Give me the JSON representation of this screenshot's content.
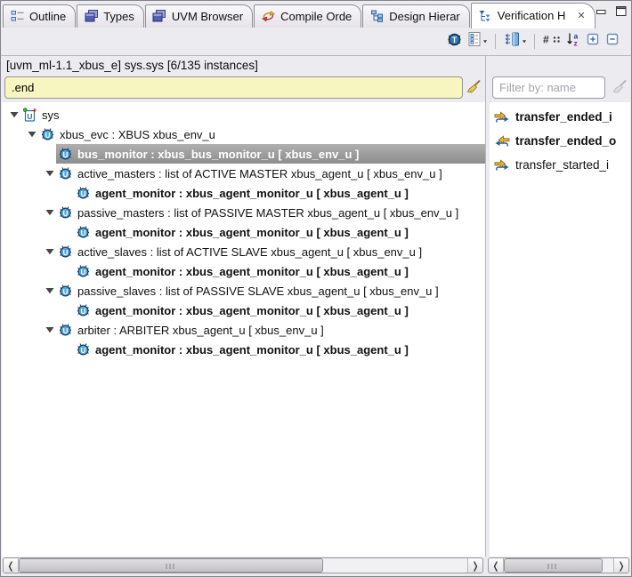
{
  "tabs": [
    {
      "label": "Outline",
      "icon": "outline-icon"
    },
    {
      "label": "Types",
      "icon": "types-icon"
    },
    {
      "label": "UVM Browser",
      "icon": "uvm-browser-icon"
    },
    {
      "label": "Compile Orde",
      "icon": "compile-order-icon"
    },
    {
      "label": "Design Hierar",
      "icon": "design-hierarchy-icon"
    },
    {
      "label": "Verification H",
      "icon": "verification-hierarchy-icon",
      "active": true,
      "close_icon": "close-icon"
    }
  ],
  "window_controls": [
    {
      "icon": "minimize-icon"
    },
    {
      "icon": "maximize-icon"
    }
  ],
  "toolbar": {
    "buttons": [
      {
        "icon": "type-filter-bug-icon"
      },
      {
        "icon": "checklist-icon",
        "dropdown": true
      },
      {
        "separator": true
      },
      {
        "icon": "column-settings-icon",
        "dropdown": true
      },
      {
        "separator": true
      },
      {
        "icon": "hash-columns-icon"
      },
      {
        "icon": "sort-az-icon"
      },
      {
        "icon": "expand-all-icon"
      },
      {
        "icon": "collapse-all-icon"
      }
    ]
  },
  "context_bar": {
    "label": "[uvm_ml-1.1_xbus_e] sys.sys [6/135 instances]"
  },
  "search": {
    "value": ".end",
    "clear_icon": "broom-icon"
  },
  "filter": {
    "placeholder": "Filter by: name",
    "clear_icon": "broom-icon-disabled"
  },
  "tree": {
    "rows": [
      {
        "label": "sys",
        "level": 0,
        "icon": "uvm-top-unit-icon",
        "expandable": true,
        "bold": false,
        "selected": false
      },
      {
        "label": "xbus_evc : XBUS xbus_env_u",
        "level": 1,
        "icon": "uvm-unit-icon",
        "expandable": true,
        "bold": false,
        "selected": false
      },
      {
        "label": "bus_monitor : xbus_bus_monitor_u [ xbus_env_u ]",
        "level": 2,
        "icon": "uvm-unit-icon",
        "expandable": false,
        "bold": true,
        "selected": true
      },
      {
        "label": "active_masters : list of ACTIVE MASTER xbus_agent_u [ xbus_env_u ]",
        "level": 2,
        "icon": "uvm-unit-icon",
        "expandable": true,
        "bold": false,
        "selected": false
      },
      {
        "label": "agent_monitor : xbus_agent_monitor_u [ xbus_agent_u ]",
        "level": 3,
        "icon": "uvm-unit-icon",
        "expandable": false,
        "bold": true,
        "selected": false
      },
      {
        "label": "passive_masters : list of PASSIVE MASTER xbus_agent_u [ xbus_env_u ]",
        "level": 2,
        "icon": "uvm-unit-icon",
        "expandable": true,
        "bold": false,
        "selected": false
      },
      {
        "label": "agent_monitor : xbus_agent_monitor_u [ xbus_agent_u ]",
        "level": 3,
        "icon": "uvm-unit-icon",
        "expandable": false,
        "bold": true,
        "selected": false
      },
      {
        "label": "active_slaves : list of ACTIVE SLAVE xbus_agent_u [ xbus_env_u ]",
        "level": 2,
        "icon": "uvm-unit-icon",
        "expandable": true,
        "bold": false,
        "selected": false
      },
      {
        "label": "agent_monitor : xbus_agent_monitor_u [ xbus_agent_u ]",
        "level": 3,
        "icon": "uvm-unit-icon",
        "expandable": false,
        "bold": true,
        "selected": false
      },
      {
        "label": "passive_slaves : list of PASSIVE SLAVE xbus_agent_u [ xbus_env_u ]",
        "level": 2,
        "icon": "uvm-unit-icon",
        "expandable": true,
        "bold": false,
        "selected": false
      },
      {
        "label": "agent_monitor : xbus_agent_monitor_u [ xbus_agent_u ]",
        "level": 3,
        "icon": "uvm-unit-icon",
        "expandable": false,
        "bold": true,
        "selected": false
      },
      {
        "label": "arbiter : ARBITER xbus_agent_u [ xbus_env_u ]",
        "level": 2,
        "icon": "uvm-unit-icon",
        "expandable": true,
        "bold": false,
        "selected": false
      },
      {
        "label": "agent_monitor : xbus_agent_monitor_u [ xbus_agent_u ]",
        "level": 3,
        "icon": "uvm-unit-icon",
        "expandable": false,
        "bold": true,
        "selected": false
      }
    ]
  },
  "ports": {
    "items": [
      {
        "label": "transfer_ended_i",
        "icon": "event-in-port-icon",
        "bold": true
      },
      {
        "label": "transfer_ended_o",
        "icon": "event-out-port-icon",
        "bold": true
      },
      {
        "label": "transfer_started_i",
        "icon": "event-in-port-icon",
        "bold": false
      }
    ]
  },
  "scrollbars": {
    "left_thumb_percent": 63,
    "right_thumb_percent": 68
  },
  "colors": {
    "chrome_background": "#ecebef",
    "pane_background": "#ffffff",
    "selection_background": "#9b9b9b",
    "selection_text": "#ffffff",
    "search_background": "#f7f6c0",
    "unit_icon_blue": "#57a7d8",
    "port_icon_gold": "#e8b33c",
    "port_icon_blue": "#2a5fa5"
  }
}
